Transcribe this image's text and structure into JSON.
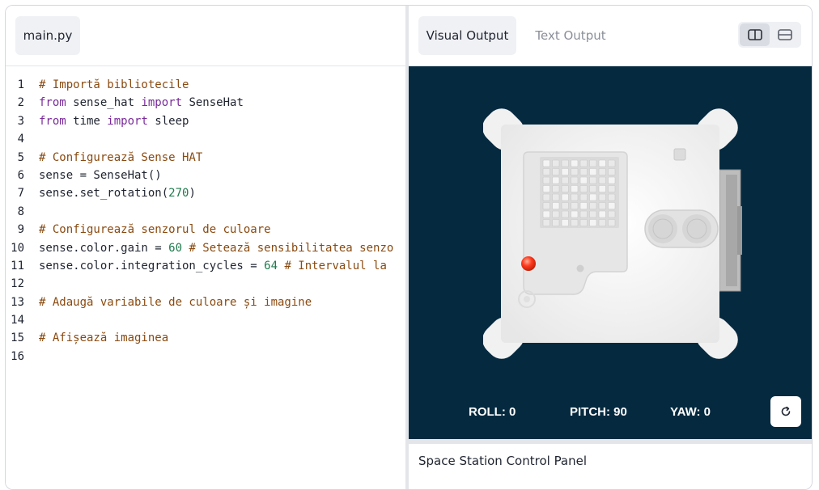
{
  "editor": {
    "file_tab": "main.py",
    "lines": [
      {
        "n": "1",
        "tokens": [
          {
            "t": "# Importă bibliotecile",
            "c": "comment"
          }
        ]
      },
      {
        "n": "2",
        "tokens": [
          {
            "t": "from",
            "c": "kw"
          },
          {
            "t": " sense_hat ",
            "c": "plain"
          },
          {
            "t": "import",
            "c": "kw"
          },
          {
            "t": " SenseHat",
            "c": "plain"
          }
        ]
      },
      {
        "n": "3",
        "tokens": [
          {
            "t": "from",
            "c": "kw"
          },
          {
            "t": " time ",
            "c": "plain"
          },
          {
            "t": "import",
            "c": "kw"
          },
          {
            "t": " sleep",
            "c": "plain"
          }
        ]
      },
      {
        "n": "4",
        "tokens": []
      },
      {
        "n": "5",
        "tokens": [
          {
            "t": "# Configurează Sense HAT",
            "c": "comment"
          }
        ]
      },
      {
        "n": "6",
        "tokens": [
          {
            "t": "sense = SenseHat()",
            "c": "plain"
          }
        ]
      },
      {
        "n": "7",
        "tokens": [
          {
            "t": "sense.set_rotation(",
            "c": "plain"
          },
          {
            "t": "270",
            "c": "num"
          },
          {
            "t": ")",
            "c": "plain"
          }
        ]
      },
      {
        "n": "8",
        "tokens": []
      },
      {
        "n": "9",
        "tokens": [
          {
            "t": "# Configurează senzorul de culoare",
            "c": "comment"
          }
        ]
      },
      {
        "n": "10",
        "tokens": [
          {
            "t": "sense.color.gain = ",
            "c": "plain"
          },
          {
            "t": "60",
            "c": "num"
          },
          {
            "t": " # Setează sensibilitatea senzo",
            "c": "comment"
          }
        ]
      },
      {
        "n": "11",
        "tokens": [
          {
            "t": "sense.color.integration_cycles = ",
            "c": "plain"
          },
          {
            "t": "64",
            "c": "num"
          },
          {
            "t": " # Intervalul la",
            "c": "comment"
          }
        ]
      },
      {
        "n": "12",
        "tokens": []
      },
      {
        "n": "13",
        "tokens": [
          {
            "t": "# Adaugă variabile de culoare și imagine",
            "c": "comment"
          }
        ]
      },
      {
        "n": "14",
        "tokens": []
      },
      {
        "n": "15",
        "tokens": [
          {
            "t": "# Afișează imaginea",
            "c": "comment"
          }
        ]
      },
      {
        "n": "16",
        "tokens": []
      }
    ]
  },
  "output": {
    "tabs": [
      {
        "label": "Visual Output",
        "active": true
      },
      {
        "label": "Text Output",
        "active": false
      }
    ],
    "layout_icons": [
      "columns-layout-icon",
      "rows-layout-icon"
    ],
    "roll_label": "ROLL: 0",
    "pitch_label": "PITCH: 90",
    "yaw_label": "YAW: 0",
    "reset_icon": "refresh-icon",
    "panel_title": "Space Station Control Panel"
  },
  "colors": {
    "stage_background": "#052a40",
    "led_indicator": "#ff3b1f",
    "comment": "#8a4a10",
    "keyword": "#7a2a9a",
    "number": "#1f7a4d"
  }
}
